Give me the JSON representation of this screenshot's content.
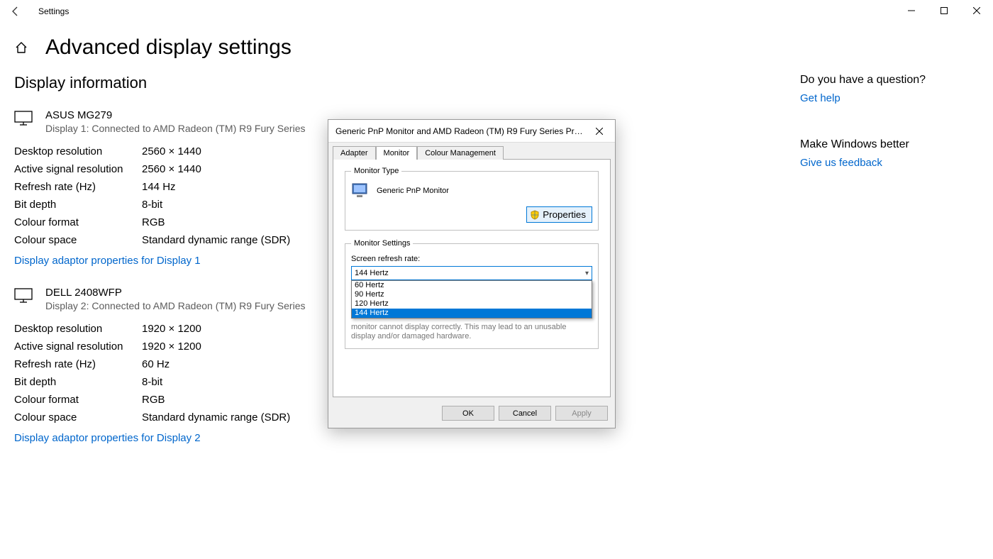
{
  "window": {
    "title": "Settings"
  },
  "page": {
    "title": "Advanced display settings"
  },
  "section_title": "Display information",
  "labels": {
    "desktop_resolution": "Desktop resolution",
    "active_signal_resolution": "Active signal resolution",
    "refresh_rate": "Refresh rate (Hz)",
    "bit_depth": "Bit depth",
    "colour_format": "Colour format",
    "colour_space": "Colour space"
  },
  "displays": [
    {
      "name": "ASUS MG279",
      "subtitle": "Display 1: Connected to AMD Radeon (TM) R9 Fury Series",
      "desktop_resolution": "2560 × 1440",
      "active_signal_resolution": "2560 × 1440",
      "refresh_rate": "144 Hz",
      "bit_depth": "8-bit",
      "colour_format": "RGB",
      "colour_space": "Standard dynamic range (SDR)",
      "adaptor_link": "Display adaptor properties for Display 1"
    },
    {
      "name": "DELL 2408WFP",
      "subtitle": "Display 2: Connected to AMD Radeon (TM) R9 Fury Series",
      "desktop_resolution": "1920 × 1200",
      "active_signal_resolution": "1920 × 1200",
      "refresh_rate": "60 Hz",
      "bit_depth": "8-bit",
      "colour_format": "RGB",
      "colour_space": "Standard dynamic range (SDR)",
      "adaptor_link": "Display adaptor properties for Display 2"
    }
  ],
  "sidebar": {
    "question_heading": "Do you have a question?",
    "get_help": "Get help",
    "better_heading": "Make Windows better",
    "feedback": "Give us feedback"
  },
  "dialog": {
    "title": "Generic PnP Monitor and AMD Radeon (TM) R9 Fury Series Prop...",
    "tabs": [
      "Adapter",
      "Monitor",
      "Colour Management"
    ],
    "active_tab": "Monitor",
    "monitor_type_legend": "Monitor Type",
    "monitor_type_value": "Generic PnP Monitor",
    "properties_btn": "Properties",
    "settings_legend": "Monitor Settings",
    "refresh_label": "Screen refresh rate:",
    "refresh_selected": "144 Hertz",
    "refresh_options": [
      "60 Hertz",
      "90 Hertz",
      "120 Hertz",
      "144 Hertz"
    ],
    "hidden_note": "monitor cannot display correctly. This may lead to an unusable display and/or damaged hardware.",
    "buttons": {
      "ok": "OK",
      "cancel": "Cancel",
      "apply": "Apply"
    }
  }
}
